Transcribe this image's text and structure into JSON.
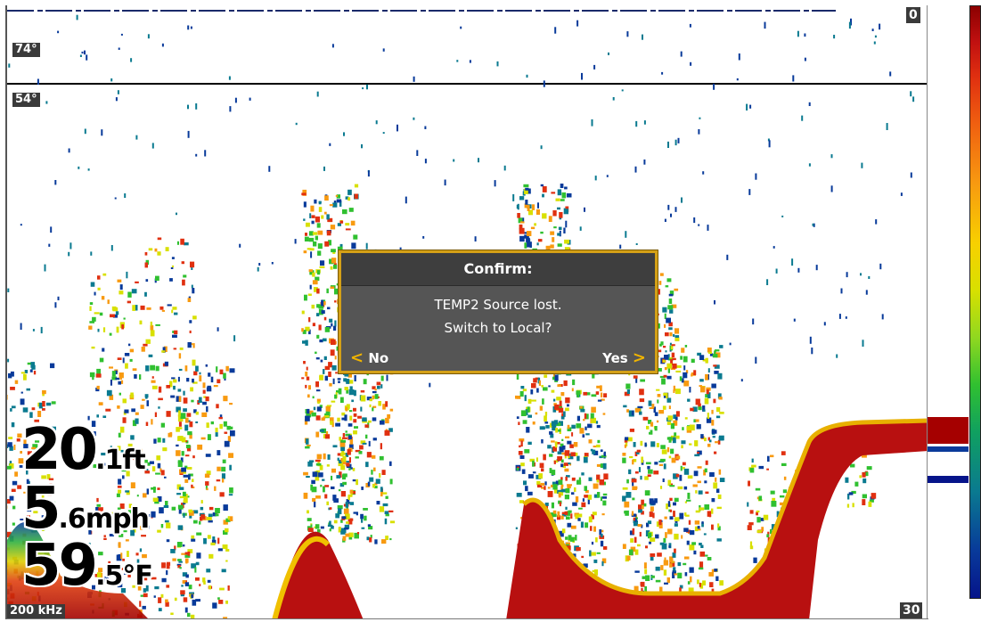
{
  "sonar": {
    "top_depth": "0",
    "bottom_depth": "30",
    "frequency": "200 kHz",
    "temp_upper": "74°",
    "temp_lower": "54°",
    "palette": [
      "#8b0000",
      "#e03010",
      "#f89a10",
      "#d8e000",
      "#30c030",
      "#0a7a90",
      "#083a9a"
    ]
  },
  "readouts": {
    "depth_value": "20",
    "depth_decimal": ".1",
    "depth_unit": "ft",
    "speed_value": "5",
    "speed_decimal": ".6",
    "speed_unit": "mph",
    "temp_value": "59",
    "temp_decimal": ".5",
    "temp_unit": "°F"
  },
  "dialog": {
    "title": "Confirm:",
    "message_line1": "TEMP2 Source lost.",
    "message_line2": "Switch to Local?",
    "no_label": "No",
    "yes_label": "Yes",
    "no_icon": "chevron-left-icon",
    "yes_icon": "chevron-right-icon"
  },
  "colors": {
    "dialog_border": "#d4a017",
    "dialog_bg": "#555555",
    "chevron": "#f0b400"
  }
}
